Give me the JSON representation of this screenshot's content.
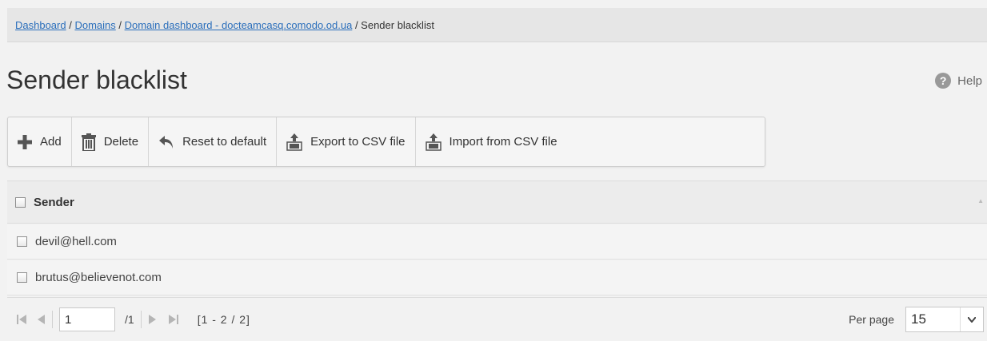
{
  "breadcrumb": {
    "items": [
      "Dashboard",
      "Domains",
      "Domain dashboard - docteamcasq.comodo.od.ua"
    ],
    "current": "Sender blacklist",
    "separator": " / "
  },
  "page": {
    "title": "Sender blacklist"
  },
  "help": {
    "label": "Help",
    "glyph": "?"
  },
  "toolbar": {
    "add": "Add",
    "delete": "Delete",
    "reset": "Reset to default",
    "export": "Export to CSV file",
    "import": "Import from CSV file"
  },
  "grid": {
    "column_header": "Sender",
    "rows": [
      "devil@hell.com",
      "brutus@believenot.com"
    ]
  },
  "pager": {
    "current_page": "1",
    "total_pages": "/1",
    "range": "[1 - 2 / 2]",
    "per_page_label": "Per page",
    "per_page_value": "15"
  },
  "colors": {
    "link": "#2a6ebb",
    "background": "#f2f2f2"
  }
}
